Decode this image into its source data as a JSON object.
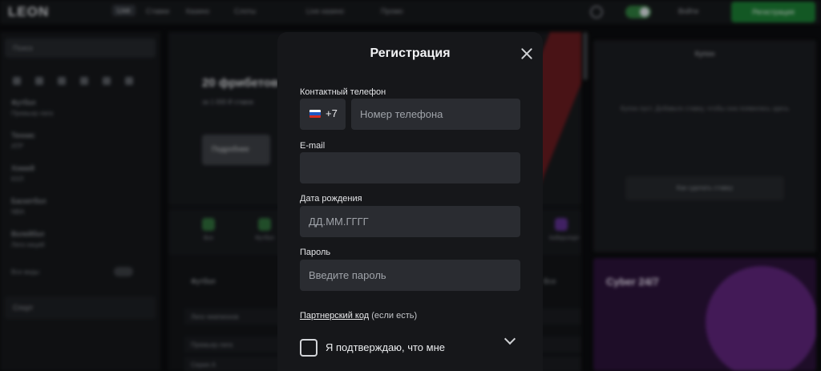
{
  "background": {
    "logo": "LEON",
    "nav": [
      "Live",
      "Ставки",
      "Казино",
      "Слоты",
      "Live казино",
      "Промо"
    ],
    "top_login": "Войти",
    "top_register": "Регистрация",
    "sidebar_search": "Поиск",
    "sidebar_blocks": [
      {
        "title": "Футбол",
        "sub": "Премьер-лига"
      },
      {
        "title": "Теннис",
        "sub": "ATP"
      },
      {
        "title": "Хоккей",
        "sub": "КХЛ"
      },
      {
        "title": "Баскетбол",
        "sub": "NBA"
      },
      {
        "title": "Волейбол",
        "sub": "Лига наций"
      }
    ],
    "sidebar_all": "Все виды",
    "sidebar_section": "Спорт",
    "hero_title": "20 фрибетов",
    "hero_sub": "за 1 000 ₽ ставок",
    "hero_button": "Подробнее",
    "categories": [
      "Все",
      "Футбол",
      "Теннис",
      "Хоккей",
      "Киберспорт"
    ],
    "sort_label": "Футбол",
    "sort_right": "Все",
    "rows": [
      "Лига чемпионов",
      "Премьер-лига",
      "Серия А"
    ],
    "right_title": "Купон",
    "right_text": "Купон пуст. Добавьте ставку, чтобы она появилась здесь",
    "right_button": "Как сделать ставку",
    "promo_text": "Cyber 24/7"
  },
  "modal": {
    "title": "Регистрация",
    "phone": {
      "label": "Контактный телефон",
      "country_code": "+7",
      "placeholder": "Номер телефона"
    },
    "email": {
      "label": "E-mail",
      "value": ""
    },
    "birthdate": {
      "label": "Дата рождения",
      "placeholder": "ДД.ММ.ГГГГ"
    },
    "password": {
      "label": "Пароль",
      "placeholder": "Введите пароль"
    },
    "partner": {
      "link": "Партнерский код",
      "suffix": "(если есть)"
    },
    "confirm_text": "Я подтверждаю, что мне",
    "flag_colors": [
      "#ffffff",
      "#1c57c4",
      "#d52b1e"
    ]
  }
}
